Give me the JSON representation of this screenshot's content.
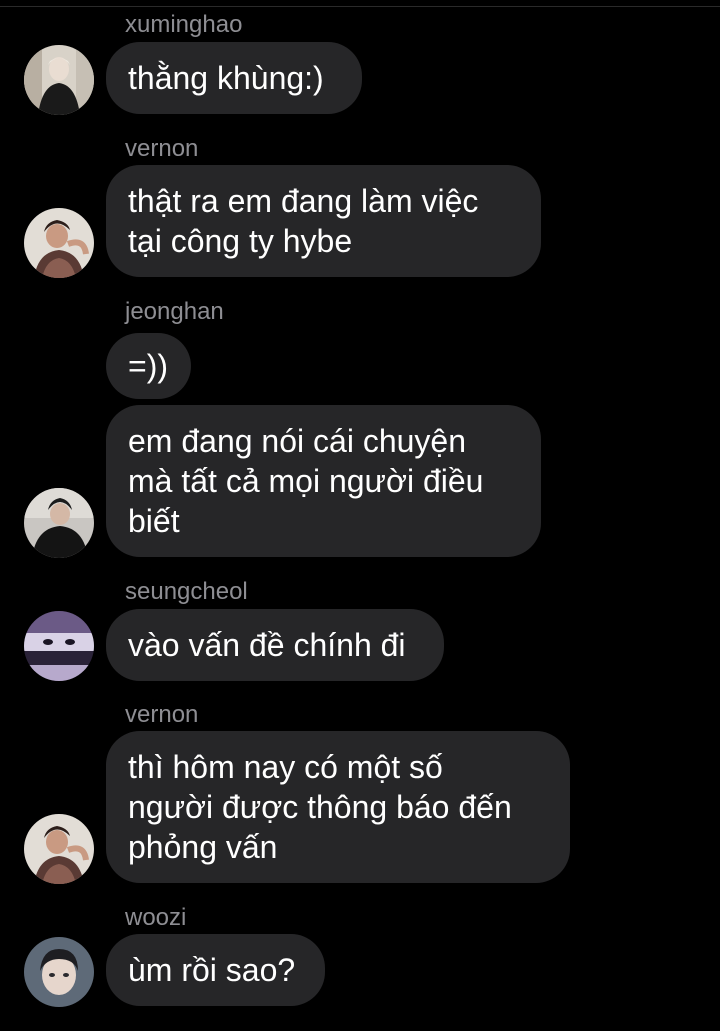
{
  "messages": [
    {
      "sender": "xuminghao",
      "text": "thằng khùng:)"
    },
    {
      "sender": "vernon",
      "text": "thật ra em đang làm việc\ntại công ty hybe"
    },
    {
      "sender": "jeonghan",
      "text": "=))"
    },
    {
      "sender": "",
      "text": "em đang nói cái chuyện\nmà tất cả mọi người điều\nbiết"
    },
    {
      "sender": "seungcheol",
      "text": "vào vấn đề chính đi"
    },
    {
      "sender": "vernon",
      "text": "thì hôm nay có một số\nngười được thông báo đến\nphỏng vấn"
    },
    {
      "sender": "woozi",
      "text": "ùm rồi sao?"
    }
  ],
  "colors": {
    "background": "#000000",
    "bubble": "#262628",
    "sender_text": "#8e8e93",
    "message_text": "#ffffff"
  }
}
